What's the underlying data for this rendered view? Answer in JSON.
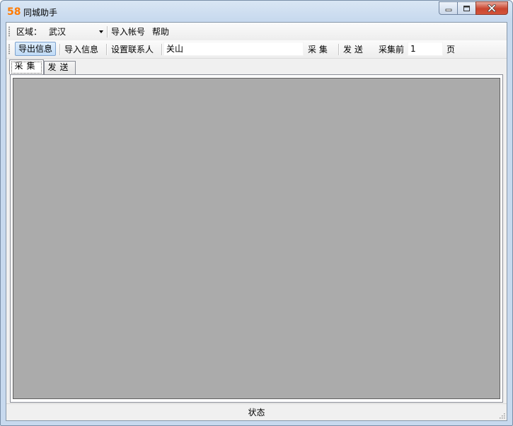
{
  "window": {
    "icon_text": "58",
    "title": "同城助手",
    "accent_color": "#ff7a00"
  },
  "caption_buttons": {
    "minimize": "minimize-icon",
    "maximize": "maximize-icon",
    "close": "close-icon"
  },
  "toolbar1": {
    "region_label": "区域：",
    "region_value": "武汉",
    "import_accounts": "导入帐号",
    "help": "帮助"
  },
  "toolbar2": {
    "export_info": "导出信息",
    "import_info": "导入信息",
    "set_contact": "设置联系人",
    "keyword_value": "关山",
    "collect": "采 集",
    "send": "发 送",
    "collect_first_label": "采集前",
    "pages_value": "1",
    "page_unit": "页"
  },
  "tabs": [
    {
      "label": "采集",
      "active": true
    },
    {
      "label": "发送",
      "active": false
    }
  ],
  "content": {
    "background_color": "#ababab"
  },
  "statusbar": {
    "status_text": "状态"
  }
}
